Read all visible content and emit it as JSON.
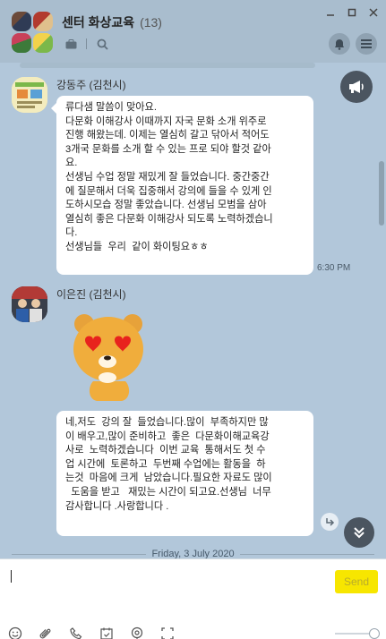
{
  "header": {
    "title": "센터 화상교육",
    "count": "(13)"
  },
  "messages": [
    {
      "sender": "강동주 (김천시)",
      "lines": [
        "류다샘 말씀이 맞아요.",
        "다문화 이해강사 이때까지 자국 문화 소개 위주로",
        "진행 해왔는데. 이제는 열심히 갈고 닦아서 적어도",
        "3개국 문화를 소개 할 수 있는 프로 되야 할것 같아",
        "요.",
        "선생님 수업 정말 재밌게 잘 들었습니다. 중간중간",
        "에 질문해서 더욱 집중해서 강의에 들을 수 있게 인",
        "도하시모습 정말 좋았습니다. 선생님 모범을 삼아",
        "열심히 좋은 다문화 이해강사 되도록 노력하겠습니",
        "다.",
        "선생님들  우리  같이 화이팅요ㅎㅎ"
      ],
      "time": "6:30 PM"
    },
    {
      "sender": "이은진 (김천시)",
      "lines": [
        "네,저도  강의 잘  들었습니다.많이  부족하지만 많",
        "이 배우고,많이 준비하고  좋은  다문화이해교육강",
        "사로  노력하겠습니다  이번 교육  통해서도 첫 수",
        "업 시간에  토론하고  두번째 수업에는 활동을  하",
        "는것  마음에 크게  남았습니다.필요한 자료도 많이",
        "  도움을 받고   재밌는 시간이 되고요.선생님  너무",
        "감사합니다 .사랑합니다 ."
      ]
    }
  ],
  "date_divider": "Friday, 3 July 2020",
  "composer": {
    "send_label": "Send"
  },
  "icons": {
    "header": [
      "briefcase-icon",
      "search-icon",
      "minimize-icon",
      "maximize-icon",
      "close-icon",
      "bell-icon",
      "menu-icon"
    ],
    "chat": [
      "announcement-icon",
      "share-icon",
      "scroll-down-icon"
    ],
    "toolbar": [
      "emoji-icon",
      "attach-icon",
      "call-icon",
      "calendar-icon",
      "poll-icon",
      "screen-capture-icon"
    ]
  },
  "colors": {
    "chat_background": "#b2c7da",
    "send_button": "#f7e600",
    "bubble": "#ffffff"
  }
}
